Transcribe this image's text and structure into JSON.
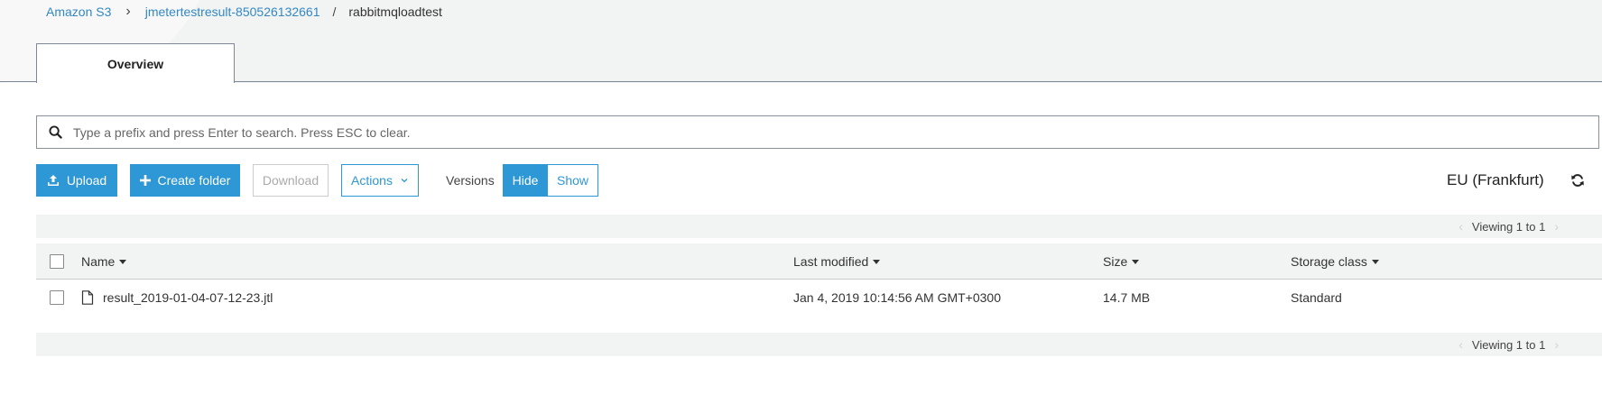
{
  "breadcrumb": {
    "root": "Amazon S3",
    "bucket": "jmetertestresult-850526132661",
    "folder": "rabbitmqloadtest",
    "sep1": "›",
    "sep2": "/"
  },
  "tabs": [
    {
      "label": "Overview"
    }
  ],
  "search": {
    "placeholder": "Type a prefix and press Enter to search. Press ESC to clear.",
    "value": ""
  },
  "toolbar": {
    "upload_label": "Upload",
    "create_folder_label": "Create folder",
    "download_label": "Download",
    "actions_label": "Actions",
    "versions_label": "Versions",
    "hide_label": "Hide",
    "show_label": "Show",
    "region": "EU (Frankfurt)"
  },
  "pager": {
    "text": "Viewing 1 to 1",
    "prev": "‹",
    "next": "›"
  },
  "table": {
    "columns": [
      "Name",
      "Last modified",
      "Size",
      "Storage class"
    ],
    "rows": [
      {
        "name": "result_2019-01-04-07-12-23.jtl",
        "last_modified": "Jan 4, 2019 10:14:56 AM GMT+0300",
        "size": "14.7 MB",
        "storage_class": "Standard"
      }
    ]
  },
  "colors": {
    "accent": "#2e97d5",
    "link": "#3388c4",
    "band": "#f2f3f3"
  },
  "icons": [
    "search-icon",
    "upload-icon",
    "plus-icon",
    "chevron-down-icon",
    "refresh-icon",
    "file-icon"
  ]
}
